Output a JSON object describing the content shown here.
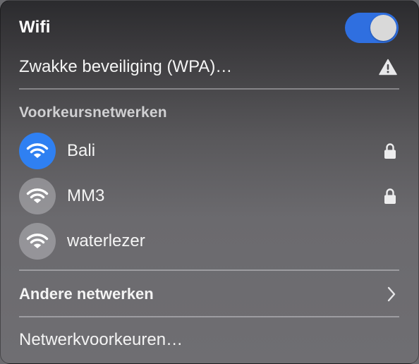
{
  "header": {
    "title": "Wifi",
    "toggle_state": "on",
    "toggle_color": "#2f6fe0"
  },
  "current_network": {
    "label": "Zwakke beveiliging (WPA)…",
    "status_icon": "warning-icon"
  },
  "preferred": {
    "section_title": "Voorkeursnetwerken",
    "networks": [
      {
        "name": "Bali",
        "connected": true,
        "secured": true,
        "icon": "wifi-icon"
      },
      {
        "name": "MM3",
        "connected": false,
        "secured": true,
        "icon": "wifi-icon"
      },
      {
        "name": "waterlezer",
        "connected": false,
        "secured": false,
        "icon": "wifi-icon"
      }
    ]
  },
  "other_networks": {
    "label": "Andere netwerken",
    "icon": "chevron-right-icon"
  },
  "footer": {
    "preferences_label": "Netwerkvoorkeuren…"
  },
  "colors": {
    "active_network": "#2f80f2",
    "accent": "#2f6fe0"
  }
}
